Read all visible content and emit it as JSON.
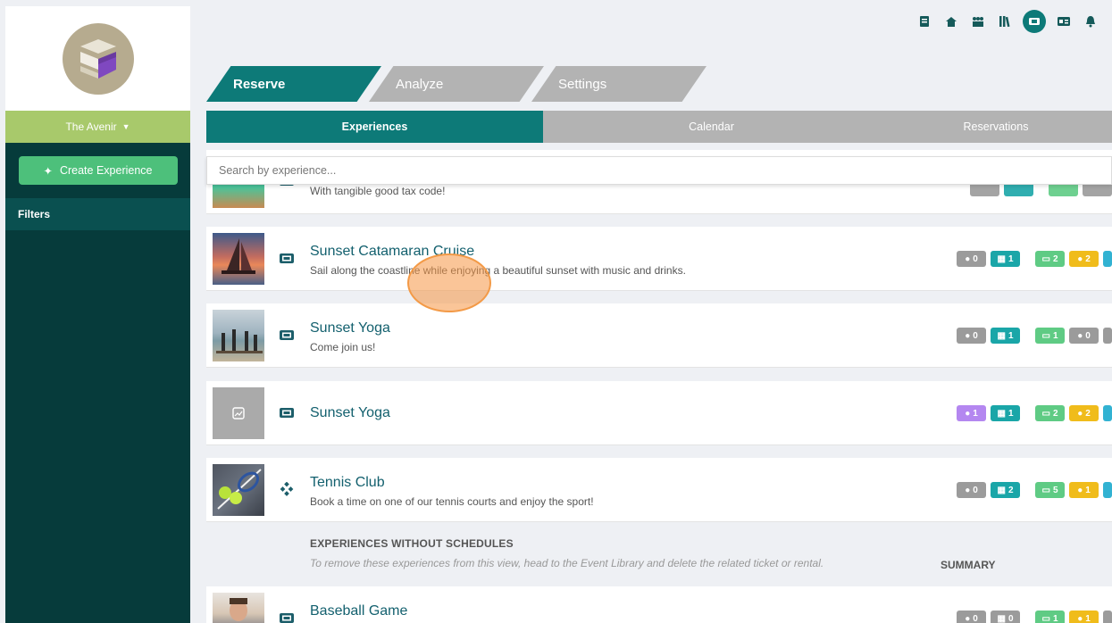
{
  "sidebar": {
    "property_name": "The Avenir",
    "create_label": "Create Experience",
    "filters_label": "Filters"
  },
  "topbar": {
    "icons": [
      "receipt-icon",
      "home-icon",
      "users-icon",
      "library-icon",
      "ticket-icon",
      "id-card-icon",
      "bell-icon"
    ]
  },
  "main_tabs": [
    "Reserve",
    "Analyze",
    "Settings"
  ],
  "sub_tabs": [
    "Experiences",
    "Calendar",
    "Reservations"
  ],
  "search": {
    "placeholder": "Search by experience..."
  },
  "rows": [
    {
      "title": "",
      "desc": "With tangible good tax code!",
      "badges": []
    },
    {
      "title": "Sunset Catamaran Cruise",
      "desc": "Sail along the coastline while enjoying a beautiful sunset with music and drinks.",
      "badges": [
        "0",
        "1",
        "2",
        "2"
      ]
    },
    {
      "title": "Sunset Yoga",
      "desc": "Come join us!",
      "badges": [
        "0",
        "1",
        "1",
        "0"
      ]
    },
    {
      "title": "Sunset Yoga",
      "desc": "",
      "badges": [
        "1",
        "1",
        "2",
        "2"
      ]
    },
    {
      "title": "Tennis Club",
      "desc": "Book a time on one of our tennis courts and enjoy the sport!",
      "badges": [
        "0",
        "2",
        "5",
        "1"
      ]
    },
    {
      "title": "Baseball Game",
      "desc": "",
      "badges": [
        "0",
        "0",
        "1",
        "1"
      ]
    }
  ],
  "no_schedule": {
    "heading": "EXPERIENCES WITHOUT SCHEDULES",
    "note": "To remove these experiences from this view, head to the Event Library and delete the related ticket or rental.",
    "summary_label": "SUMMARY"
  },
  "colors": {
    "primary": "#0d7a78",
    "sidebar": "#063b3b",
    "accent_green": "#a8c96b",
    "button": "#4dc07b"
  }
}
